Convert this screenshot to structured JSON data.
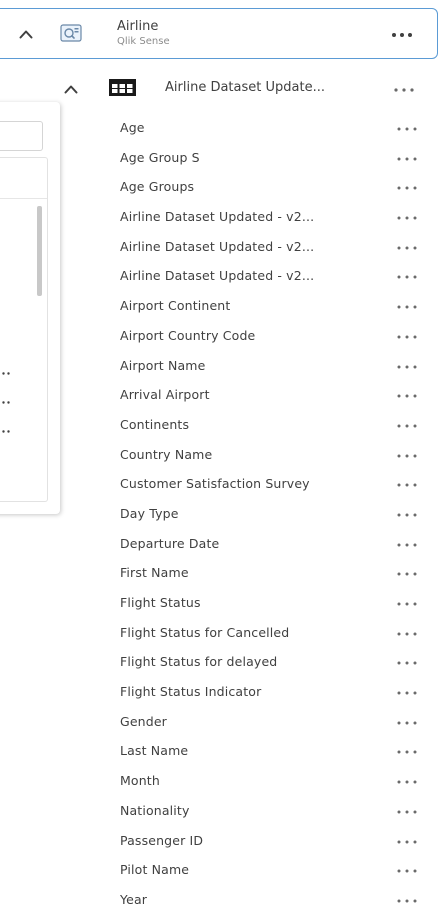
{
  "source": {
    "title": "Airline",
    "subtitle": "Qlik Sense"
  },
  "dataset": {
    "title": "Airline Dataset Update..."
  },
  "fields": [
    {
      "label": "Age"
    },
    {
      "label": "Age Group S"
    },
    {
      "label": "Age Groups"
    },
    {
      "label": "Airline Dataset Updated - v2..."
    },
    {
      "label": "Airline Dataset Updated - v2..."
    },
    {
      "label": "Airline Dataset Updated - v2..."
    },
    {
      "label": "Airport Continent"
    },
    {
      "label": "Airport Country Code"
    },
    {
      "label": "Airport Name"
    },
    {
      "label": "Arrival Airport"
    },
    {
      "label": "Continents"
    },
    {
      "label": "Country Name"
    },
    {
      "label": "Customer Satisfaction Survey"
    },
    {
      "label": "Day Type"
    },
    {
      "label": "Departure Date"
    },
    {
      "label": "First Name"
    },
    {
      "label": "Flight Status"
    },
    {
      "label": "Flight Status for Cancelled"
    },
    {
      "label": "Flight Status for delayed"
    },
    {
      "label": "Flight Status Indicator"
    },
    {
      "label": "Gender"
    },
    {
      "label": "Last Name"
    },
    {
      "label": "Month"
    },
    {
      "label": "Nationality"
    },
    {
      "label": "Passenger ID"
    },
    {
      "label": "Pilot Name"
    },
    {
      "label": "Year"
    }
  ],
  "icons": {
    "chevron": "chevron-up-icon",
    "more": "more-horizontal-icon",
    "app": "qlik-app-icon",
    "table": "table-icon"
  },
  "colors": {
    "accent_border": "#5b9bd5",
    "text": "#404040",
    "subtext": "#8c8c8c"
  }
}
